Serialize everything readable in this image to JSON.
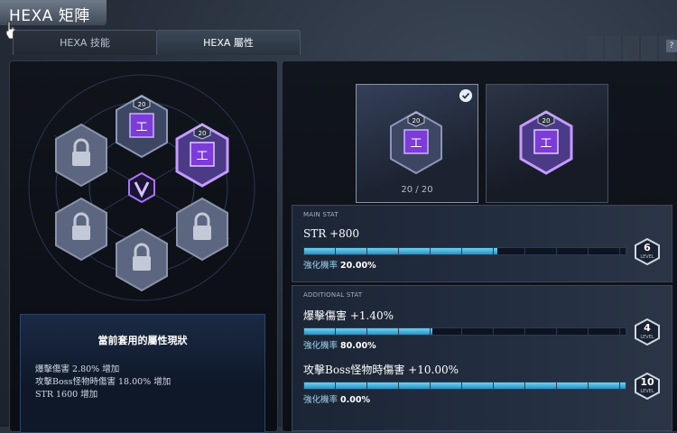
{
  "window": {
    "title": "HEXA 矩陣"
  },
  "tabs": [
    {
      "label": "HEXA 技能",
      "active": false
    },
    {
      "label": "HEXA 屬性",
      "active": true
    }
  ],
  "help": "?",
  "hex_grid": {
    "center_icon": "hexa-v-emblem-icon",
    "nodes": [
      {
        "name": "stat-node-top",
        "level": "20",
        "locked": false
      },
      {
        "name": "stat-node-upper-right",
        "level": "20",
        "locked": false,
        "selected": true
      },
      {
        "name": "locked-node-upper-left",
        "locked": true
      },
      {
        "name": "locked-node-lower-left",
        "locked": true
      },
      {
        "name": "locked-node-lower-right",
        "locked": true
      },
      {
        "name": "locked-node-bottom",
        "locked": true
      }
    ]
  },
  "status": {
    "title": "當前套用的屬性現狀",
    "lines": [
      "爆擊傷害 2.80% 增加",
      "攻擊Boss怪物時傷害 18.00% 增加",
      "STR 1600 增加"
    ]
  },
  "cards": {
    "selected": {
      "level": "20",
      "count": "20 / 20"
    },
    "plain": {
      "level": "20"
    }
  },
  "main_stat": {
    "header": "MAIN STAT",
    "name": "STR +800",
    "rate_label": "強化機率",
    "rate_value": "20.00%",
    "progress": 0.6,
    "level": "6",
    "level_caption": "LEVEL"
  },
  "additional_stat": {
    "header": "ADDITIONAL STAT",
    "items": [
      {
        "name": "爆擊傷害 +1.40%",
        "rate_label": "強化機率",
        "rate_value": "80.00%",
        "progress": 0.4,
        "level": "4",
        "level_caption": "LEVEL"
      },
      {
        "name": "攻擊Boss怪物時傷害 +10.00%",
        "rate_label": "強化機率",
        "rate_value": "0.00%",
        "progress": 1.0,
        "level": "10",
        "level_caption": "LEVEL"
      }
    ]
  },
  "colors": {
    "accent": "#8f5cff",
    "bar": "#4ec3e8",
    "panel": "#0f1319"
  }
}
